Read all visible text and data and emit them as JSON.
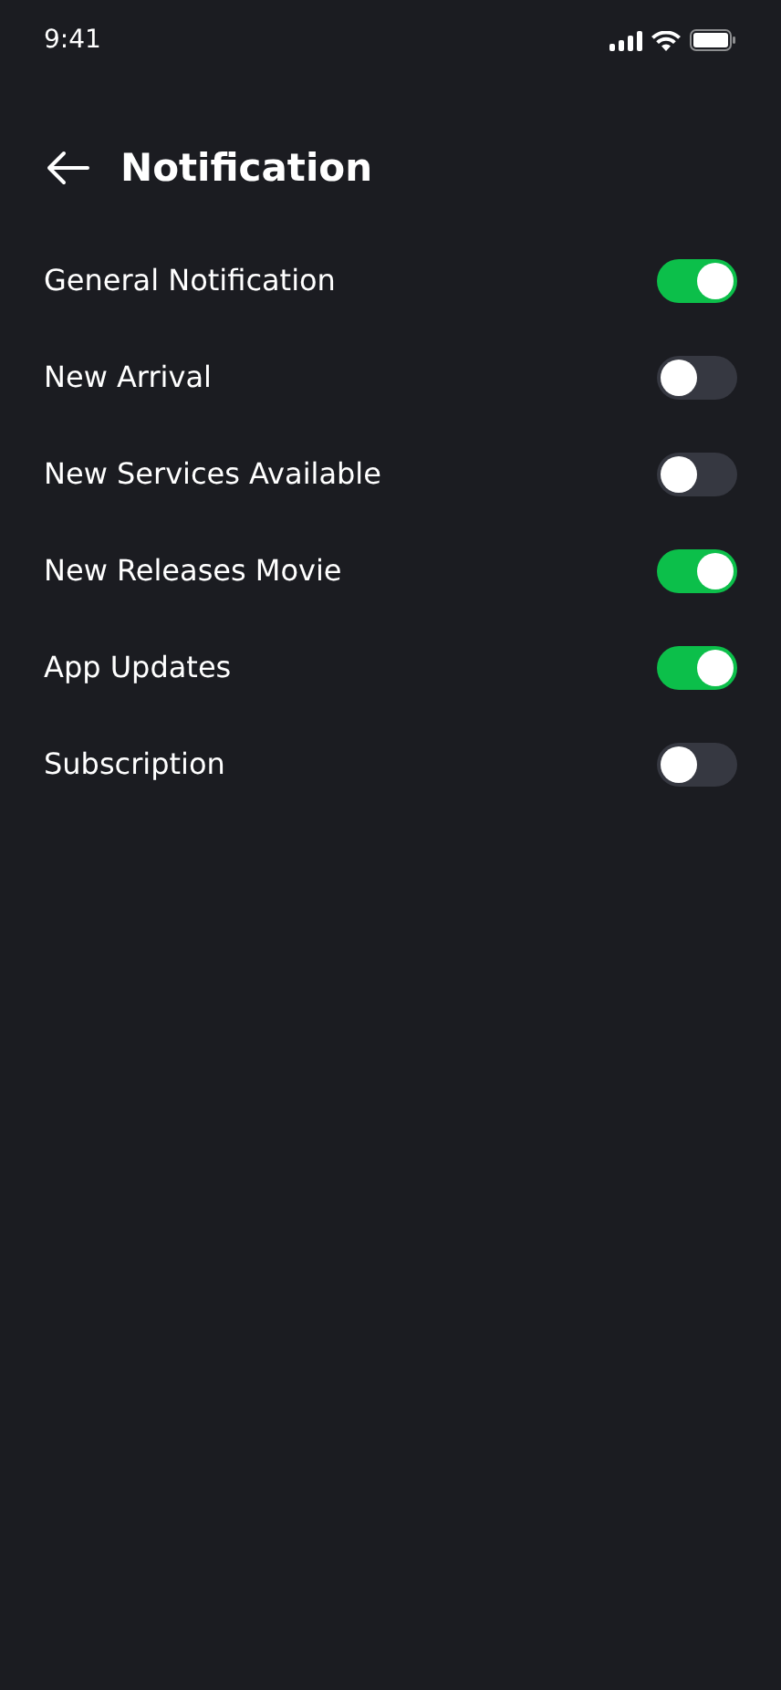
{
  "status_bar": {
    "time": "9:41"
  },
  "header": {
    "title": "Notification"
  },
  "settings": [
    {
      "label": "General Notification",
      "on": true
    },
    {
      "label": "New Arrival",
      "on": false
    },
    {
      "label": "New Services Available",
      "on": false
    },
    {
      "label": "New Releases Movie",
      "on": true
    },
    {
      "label": "App Updates",
      "on": true
    },
    {
      "label": "Subscription",
      "on": false
    }
  ]
}
